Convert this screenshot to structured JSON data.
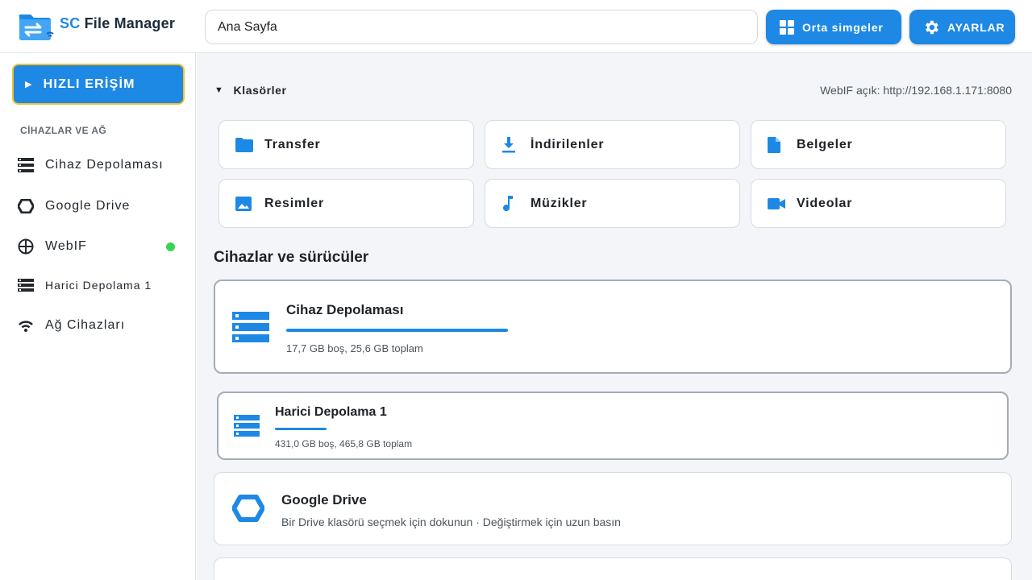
{
  "header": {
    "app_title_prefix": "SC",
    "app_title": "File Manager",
    "search_value": "Ana Sayfa",
    "view_button_label": "Orta simgeler",
    "settings_button_label": "AYARLAR"
  },
  "sidebar": {
    "quick_access_label": "HIZLI ERİŞİM",
    "section_label": "CİHAZLAR VE AĞ",
    "items": [
      {
        "label": "Cihaz Depolaması",
        "icon": "storage-icon"
      },
      {
        "label": "Google Drive",
        "icon": "google-drive-icon"
      },
      {
        "label": "WebIF",
        "icon": "globe-icon",
        "status": "online",
        "status_color": "#39d353"
      },
      {
        "label": "Harici Depolama 1",
        "icon": "storage-icon"
      },
      {
        "label": "Ağ Cihazları",
        "icon": "wifi-icon"
      }
    ]
  },
  "main": {
    "folders_label": "Klasörler",
    "webif_status": "WebIF açık: http://192.168.1.171:8080",
    "folders": [
      {
        "label": "Transfer",
        "icon": "folder-icon"
      },
      {
        "label": "İndirilenler",
        "icon": "download-icon"
      },
      {
        "label": "Belgeler",
        "icon": "document-icon"
      },
      {
        "label": "Resimler",
        "icon": "image-icon"
      },
      {
        "label": "Müzikler",
        "icon": "music-icon"
      },
      {
        "label": "Videolar",
        "icon": "video-icon"
      }
    ],
    "devices_title": "Cihazlar ve sürücüler",
    "devices": [
      {
        "name": "Cihaz Depolaması",
        "details": "17,7 GB boş, 25,6 GB toplam",
        "free_gb": 17.7,
        "total_gb": 25.6,
        "icon": "storage-icon"
      },
      {
        "name": "Harici Depolama 1",
        "details": "431,0 GB boş, 465,8 GB toplam",
        "free_gb": 431.0,
        "total_gb": 465.8,
        "icon": "storage-icon"
      },
      {
        "name": "Google Drive",
        "details": "Bir Drive klasörü seçmek için dokunun · Değiştirmek için uzun basın",
        "icon": "google-drive-icon"
      }
    ]
  },
  "colors": {
    "accent": "#1e88e5",
    "focus_border": "#f2c12e",
    "online": "#39d353"
  }
}
